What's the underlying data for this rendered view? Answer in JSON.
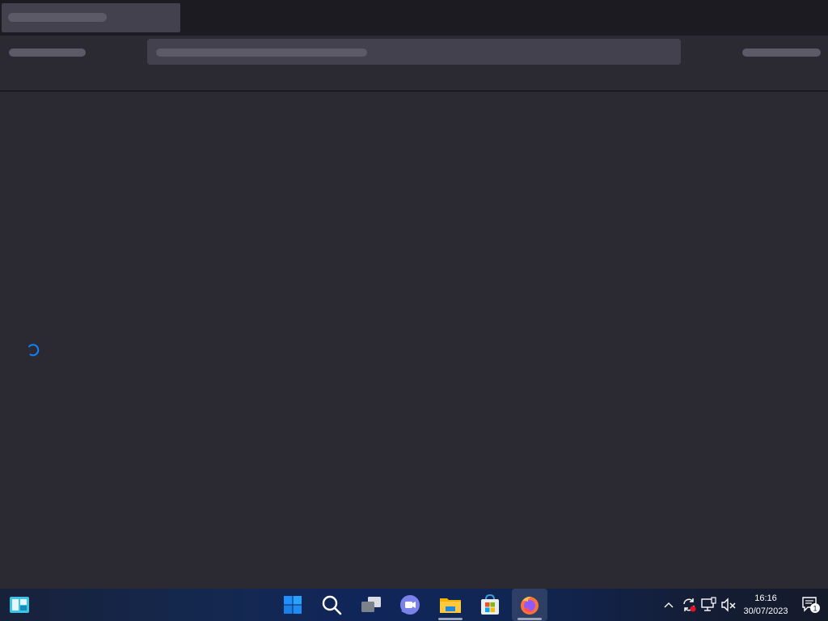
{
  "taskbar": {
    "apps": [
      {
        "name": "Start",
        "icon": "windows-start-icon"
      },
      {
        "name": "Search",
        "icon": "search-icon"
      },
      {
        "name": "Task View",
        "icon": "task-view-icon"
      },
      {
        "name": "Chat",
        "icon": "chat-camera-icon"
      },
      {
        "name": "File Explorer",
        "icon": "folder-icon"
      },
      {
        "name": "Microsoft Store",
        "icon": "store-icon"
      },
      {
        "name": "Firefox",
        "icon": "firefox-icon"
      }
    ],
    "tray_icons": [
      "chevron-up-icon",
      "sync-icon",
      "network-icon",
      "volume-muted-icon"
    ],
    "clock": {
      "time": "16:16",
      "date": "30/07/2023"
    },
    "notification_count": "1"
  },
  "colors": {
    "browser_bg": "#2b2a33",
    "tabstrip_bg": "#1c1b22",
    "spinner": "#0a84ff"
  }
}
